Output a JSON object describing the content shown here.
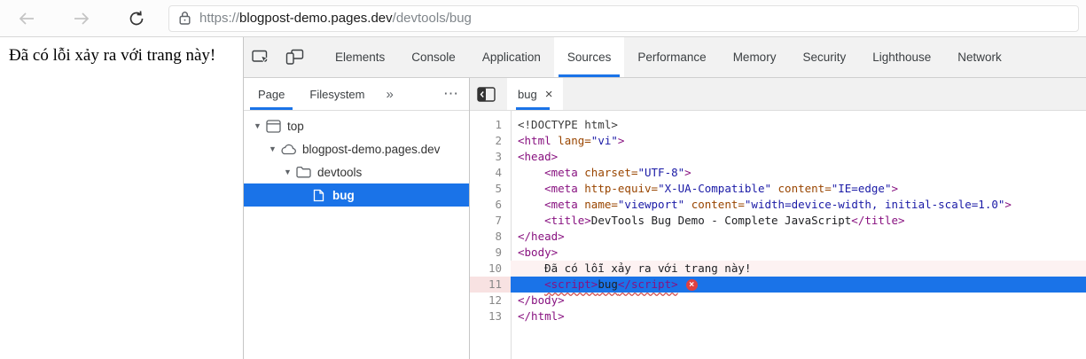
{
  "browser": {
    "address": {
      "scheme": "https://",
      "host": "blogpost-demo.pages.dev",
      "path": "/devtools/bug"
    }
  },
  "page": {
    "error_text": "Đã có lỗi xảy ra với trang này!"
  },
  "devtools": {
    "toolbar": {
      "tabs": [
        {
          "label": "Elements"
        },
        {
          "label": "Console"
        },
        {
          "label": "Application"
        },
        {
          "label": "Sources",
          "active": true
        },
        {
          "label": "Performance"
        },
        {
          "label": "Memory"
        },
        {
          "label": "Security"
        },
        {
          "label": "Lighthouse"
        },
        {
          "label": "Network"
        }
      ]
    },
    "sidebar": {
      "tabs": [
        {
          "label": "Page",
          "active": true
        },
        {
          "label": "Filesystem"
        }
      ],
      "more_tabs_glyph": "»",
      "menu_glyph": "⋯",
      "expand_glyph": "▼",
      "tree": [
        {
          "label": "top",
          "icon": "frame-icon",
          "depth": 0,
          "expanded": true
        },
        {
          "label": "blogpost-demo.pages.dev",
          "icon": "cloud-icon",
          "depth": 1,
          "expanded": true
        },
        {
          "label": "devtools",
          "icon": "folder-icon",
          "depth": 2,
          "expanded": true
        },
        {
          "label": "bug",
          "icon": "file-icon",
          "depth": 3,
          "selected": true
        }
      ]
    },
    "editor": {
      "tab": {
        "label": "bug",
        "close_glyph": "×"
      },
      "error_icon_glyph": "×",
      "lines": [
        {
          "n": 1,
          "tokens": [
            {
              "c": "meta",
              "t": "<!DOCTYPE html>"
            }
          ]
        },
        {
          "n": 2,
          "tokens": [
            {
              "c": "tag",
              "t": "<html"
            },
            {
              "c": "attr",
              "t": " lang="
            },
            {
              "c": "str",
              "t": "\"vi\""
            },
            {
              "c": "tag",
              "t": ">"
            }
          ]
        },
        {
          "n": 3,
          "tokens": [
            {
              "c": "tag",
              "t": "<head>"
            }
          ]
        },
        {
          "n": 4,
          "tokens": [
            {
              "c": "text",
              "t": "    "
            },
            {
              "c": "tag",
              "t": "<meta"
            },
            {
              "c": "attr",
              "t": " charset="
            },
            {
              "c": "str",
              "t": "\"UTF-8\""
            },
            {
              "c": "tag",
              "t": ">"
            }
          ]
        },
        {
          "n": 5,
          "tokens": [
            {
              "c": "text",
              "t": "    "
            },
            {
              "c": "tag",
              "t": "<meta"
            },
            {
              "c": "attr",
              "t": " http-equiv="
            },
            {
              "c": "str",
              "t": "\"X-UA-Compatible\""
            },
            {
              "c": "attr",
              "t": " content="
            },
            {
              "c": "str",
              "t": "\"IE=edge\""
            },
            {
              "c": "tag",
              "t": ">"
            }
          ]
        },
        {
          "n": 6,
          "tokens": [
            {
              "c": "text",
              "t": "    "
            },
            {
              "c": "tag",
              "t": "<meta"
            },
            {
              "c": "attr",
              "t": " name="
            },
            {
              "c": "str",
              "t": "\"viewport\""
            },
            {
              "c": "attr",
              "t": " content="
            },
            {
              "c": "str",
              "t": "\"width=device-width, initial-scale=1.0\""
            },
            {
              "c": "tag",
              "t": ">"
            }
          ]
        },
        {
          "n": 7,
          "tokens": [
            {
              "c": "text",
              "t": "    "
            },
            {
              "c": "tag",
              "t": "<title>"
            },
            {
              "c": "text",
              "t": "DevTools Bug Demo - Complete JavaScript"
            },
            {
              "c": "tag",
              "t": "</title>"
            }
          ]
        },
        {
          "n": 8,
          "tokens": [
            {
              "c": "tag",
              "t": "</head>"
            }
          ]
        },
        {
          "n": 9,
          "tokens": [
            {
              "c": "tag",
              "t": "<body>"
            }
          ]
        },
        {
          "n": 10,
          "tint": true,
          "tokens": [
            {
              "c": "text",
              "t": "    Đã có lỗi xảy ra với trang này!"
            }
          ]
        },
        {
          "n": 11,
          "selected": true,
          "error": true,
          "tokens": [
            {
              "c": "text",
              "t": "    "
            },
            {
              "c": "tag",
              "t": "<script>",
              "sq": true
            },
            {
              "c": "text",
              "t": "bug",
              "sq": true
            },
            {
              "c": "tag",
              "t": "</script>",
              "sq": true
            }
          ]
        },
        {
          "n": 12,
          "tokens": [
            {
              "c": "tag",
              "t": "</body>"
            }
          ]
        },
        {
          "n": 13,
          "tokens": [
            {
              "c": "tag",
              "t": "</html>"
            }
          ]
        }
      ]
    }
  },
  "colors": {
    "accent_blue": "#1a73e8",
    "selection_blue": "#1a73e8",
    "error_red": "#df4040",
    "tag_color": "#881280",
    "attribute_color": "#994500",
    "string_color": "#1a1aa6"
  }
}
